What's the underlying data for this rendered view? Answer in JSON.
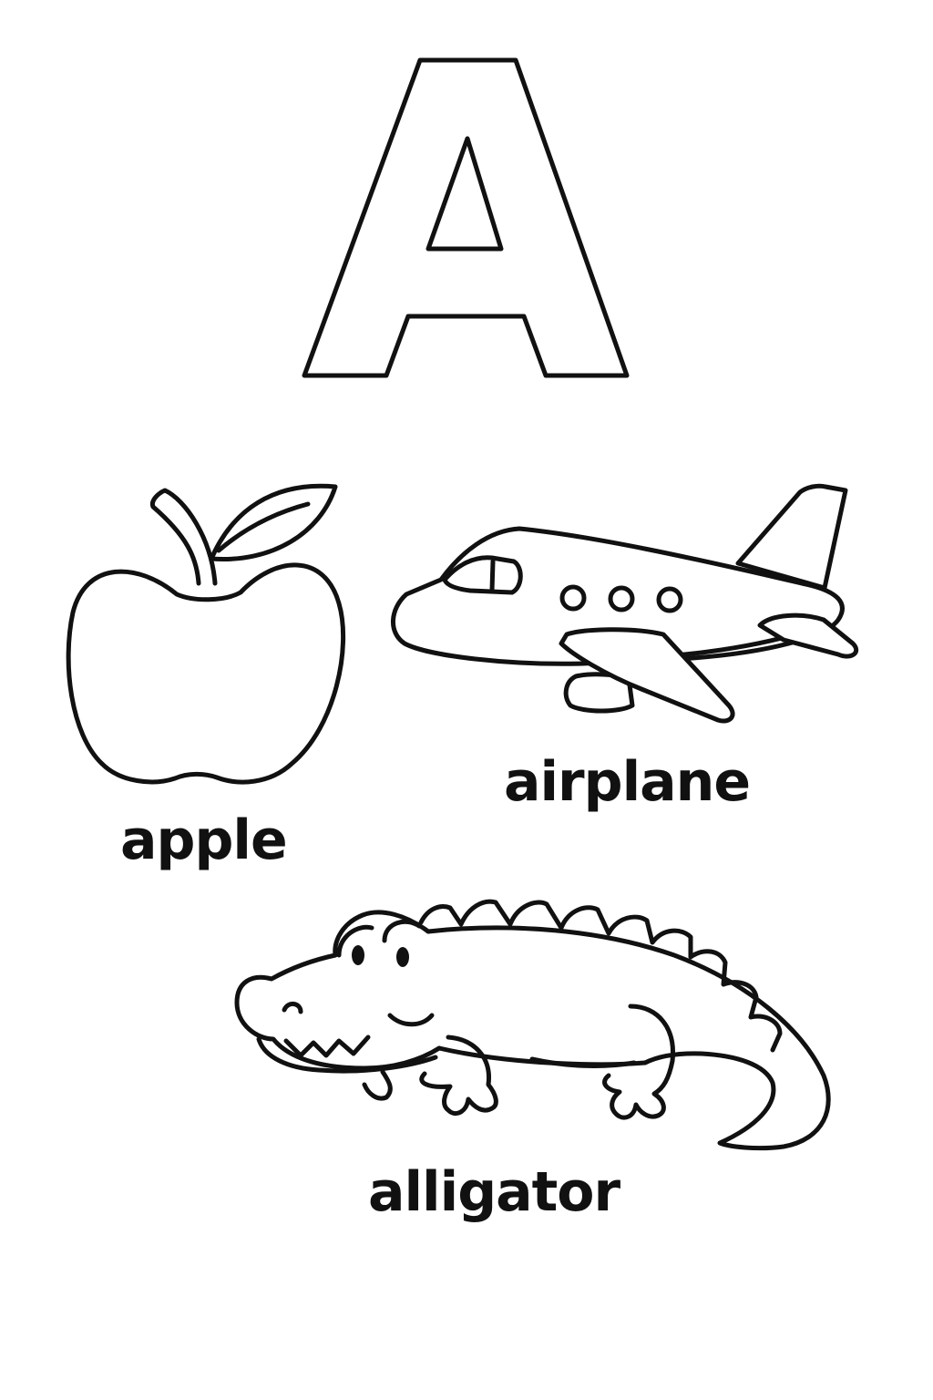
{
  "worksheet": {
    "letter": "A",
    "items": [
      {
        "word": "apple",
        "picture": "apple-outline-drawing"
      },
      {
        "word": "airplane",
        "picture": "airplane-outline-drawing"
      },
      {
        "word": "alligator",
        "picture": "alligator-outline-drawing"
      }
    ],
    "colors": {
      "line": "#111111",
      "background": "#ffffff"
    }
  }
}
